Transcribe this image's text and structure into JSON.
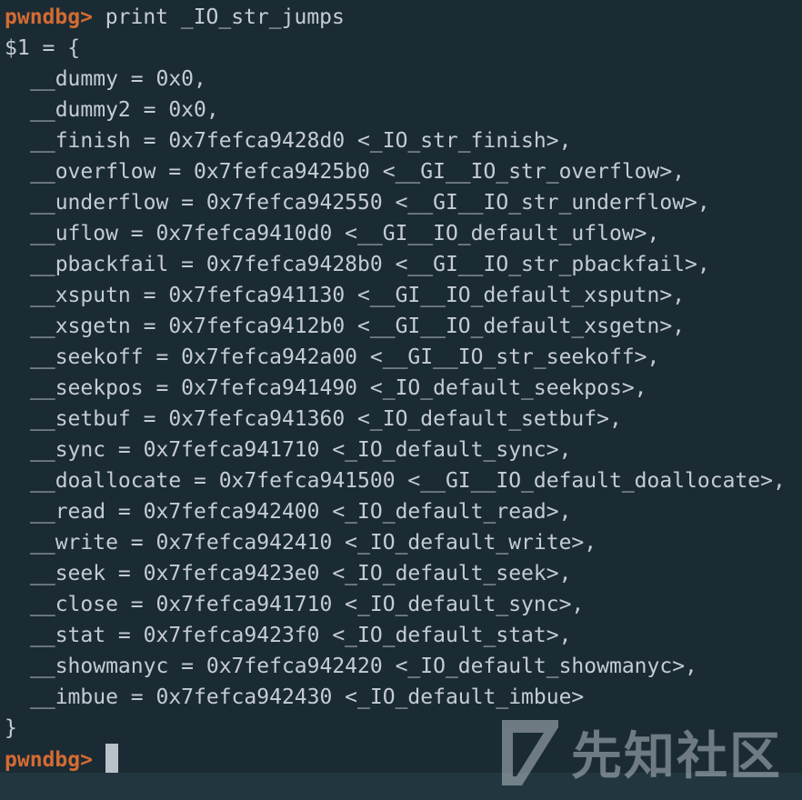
{
  "terminal": {
    "command_line": {
      "prompt": "pwndbg>",
      "command": " print _IO_str_jumps"
    },
    "result_open": "$1 = {",
    "fields": [
      "__dummy = 0x0,",
      "__dummy2 = 0x0,",
      "__finish = 0x7fefca9428d0 <_IO_str_finish>,",
      "__overflow = 0x7fefca9425b0 <__GI__IO_str_overflow>,",
      "__underflow = 0x7fefca942550 <__GI__IO_str_underflow>,",
      "__uflow = 0x7fefca9410d0 <__GI__IO_default_uflow>,",
      "__pbackfail = 0x7fefca9428b0 <__GI__IO_str_pbackfail>,",
      "__xsputn = 0x7fefca941130 <__GI__IO_default_xsputn>,",
      "__xsgetn = 0x7fefca9412b0 <__GI__IO_default_xsgetn>,",
      "__seekoff = 0x7fefca942a00 <__GI__IO_str_seekoff>,",
      "__seekpos = 0x7fefca941490 <_IO_default_seekpos>,",
      "__setbuf = 0x7fefca941360 <_IO_default_setbuf>,",
      "__sync = 0x7fefca941710 <_IO_default_sync>,",
      "__doallocate = 0x7fefca941500 <__GI__IO_default_doallocate>,",
      "__read = 0x7fefca942400 <_IO_default_read>,",
      "__write = 0x7fefca942410 <_IO_default_write>,",
      "__seek = 0x7fefca9423e0 <_IO_default_seek>,",
      "__close = 0x7fefca941710 <_IO_default_sync>,",
      "__stat = 0x7fefca9423f0 <_IO_default_stat>,",
      "__showmanyc = 0x7fefca942420 <_IO_default_showmanyc>,",
      "__imbue = 0x7fefca942430 <_IO_default_imbue>"
    ],
    "result_close": "}",
    "current_prompt": "pwndbg>"
  },
  "watermark": {
    "text": "先知社区",
    "icon": "xianzhi-logo-icon"
  },
  "colors": {
    "background": "#1b2b34",
    "prompt": "#d46b32",
    "text": "#c5ccd3",
    "cursor": "#b9c2c9"
  }
}
